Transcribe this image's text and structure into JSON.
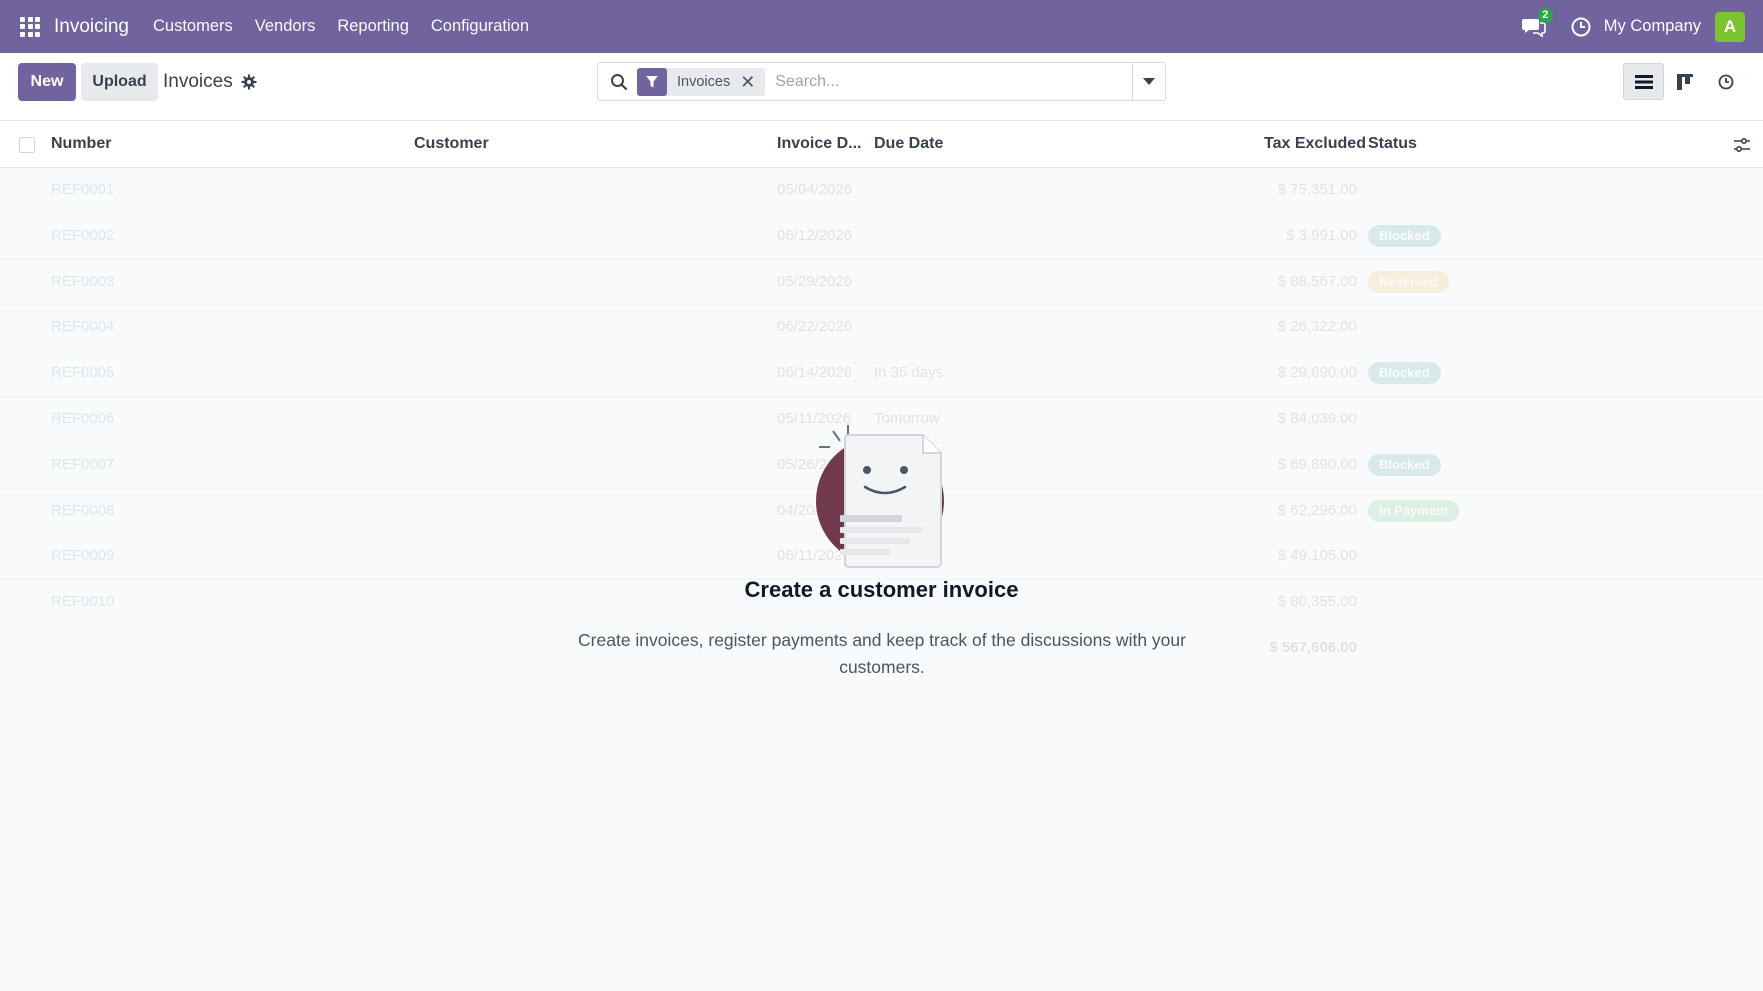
{
  "navbar": {
    "app_name": "Invoicing",
    "menu": [
      "Customers",
      "Vendors",
      "Reporting",
      "Configuration"
    ],
    "message_count": "2",
    "company": "My Company",
    "avatar_initial": "A",
    "bg_color": "#71639e"
  },
  "control": {
    "new_label": "New",
    "upload_label": "Upload",
    "breadcrumb": "Invoices",
    "search": {
      "facet_label": "Invoices",
      "placeholder": "Search..."
    }
  },
  "table": {
    "columns": [
      "Number",
      "Customer",
      "Invoice D...",
      "Due Date",
      "Tax Excluded",
      "Status"
    ],
    "rows": [
      {
        "number": "REF0001",
        "date": "05/04/2026",
        "due": "",
        "amount": "$ 75,351.00",
        "status": ""
      },
      {
        "number": "REF0002",
        "date": "06/12/2026",
        "due": "",
        "amount": "$ 3,991.00",
        "status": "Blocked"
      },
      {
        "number": "REF0003",
        "date": "05/29/2026",
        "due": "",
        "amount": "$ 88,567.00",
        "status": "Reversed"
      },
      {
        "number": "REF0004",
        "date": "06/22/2026",
        "due": "",
        "amount": "$ 26,322.00",
        "status": ""
      },
      {
        "number": "REF0005",
        "date": "06/14/2026",
        "due": "In 35 days",
        "amount": "$ 29,690.00",
        "status": "Blocked"
      },
      {
        "number": "REF0006",
        "date": "05/11/2026",
        "due": "Tomorrow",
        "amount": "$ 84,039.00",
        "status": ""
      },
      {
        "number": "REF0007",
        "date": "05/26/2026",
        "due": "",
        "amount": "$ 69,890.00",
        "status": "Blocked"
      },
      {
        "number": "REF0008",
        "date": "04/20/2026",
        "due": "",
        "amount": "$ 62,296.00",
        "status": "In Payment"
      },
      {
        "number": "REF0009",
        "date": "06/11/2026",
        "due": "",
        "amount": "$ 49,105.00",
        "status": ""
      },
      {
        "number": "REF0010",
        "date": "",
        "due": "",
        "amount": "$ 80,355.00",
        "status": ""
      }
    ],
    "total": "$ 567,606.00"
  },
  "helper": {
    "title": "Create a customer invoice",
    "description": "Create invoices, register payments and keep track of the discussions with your customers."
  }
}
